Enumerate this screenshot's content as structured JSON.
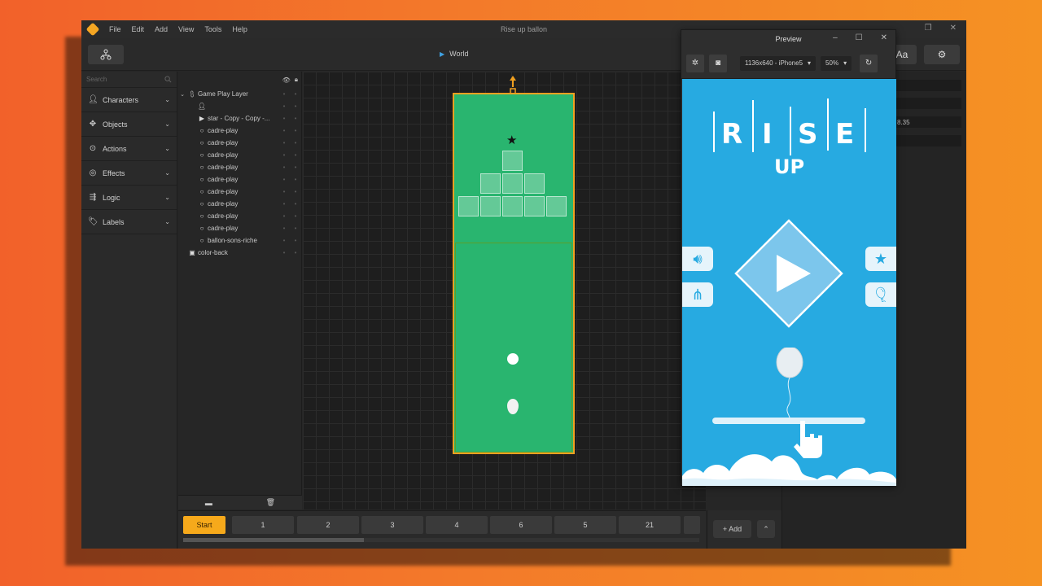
{
  "app": {
    "window_title": "Rise up ballon",
    "menu": [
      "File",
      "Edit",
      "Add",
      "View",
      "Tools",
      "Help"
    ]
  },
  "toolbar": {
    "scene_name": "World",
    "text_button": "Aa"
  },
  "left_panel": {
    "search_placeholder": "Search",
    "categories": [
      {
        "label": "Characters",
        "icon": "person-icon"
      },
      {
        "label": "Objects",
        "icon": "objects-icon"
      },
      {
        "label": "Actions",
        "icon": "play-circle-icon"
      },
      {
        "label": "Effects",
        "icon": "spiral-icon"
      },
      {
        "label": "Logic",
        "icon": "logic-icon"
      },
      {
        "label": "Labels",
        "icon": "tag-icon"
      }
    ]
  },
  "layers": {
    "rows": [
      {
        "name": "Game Play Layer",
        "icon": "layer-icon",
        "level": 0
      },
      {
        "name": "",
        "icon": "person-icon",
        "level": 1
      },
      {
        "name": "star - Copy - Copy -...",
        "icon": "play-icon",
        "level": 1
      },
      {
        "name": "cadre-play",
        "icon": "circle-icon",
        "level": 1
      },
      {
        "name": "cadre-play",
        "icon": "circle-icon",
        "level": 1
      },
      {
        "name": "cadre-play",
        "icon": "circle-icon",
        "level": 1
      },
      {
        "name": "cadre-play",
        "icon": "circle-icon",
        "level": 1
      },
      {
        "name": "cadre-play",
        "icon": "circle-icon",
        "level": 1
      },
      {
        "name": "cadre-play",
        "icon": "circle-icon",
        "level": 1
      },
      {
        "name": "cadre-play",
        "icon": "circle-icon",
        "level": 1
      },
      {
        "name": "cadre-play",
        "icon": "circle-icon",
        "level": 1
      },
      {
        "name": "cadre-play",
        "icon": "circle-icon",
        "level": 1
      },
      {
        "name": "ballon-sons-riche",
        "icon": "circle-icon",
        "level": 1
      },
      {
        "name": "color-back",
        "icon": "image-icon",
        "level": 0
      }
    ]
  },
  "timeline": {
    "scenes": [
      "Start",
      "1",
      "2",
      "3",
      "4",
      "6",
      "5",
      "21"
    ],
    "add_label": "+ Add"
  },
  "properties": {
    "value": "8.35"
  },
  "preview": {
    "title": "Preview",
    "device": "1136x640 - iPhone5",
    "zoom": "50%",
    "game": {
      "logo_letters": [
        "R",
        "I",
        "S",
        "E"
      ],
      "logo_sub": "UP"
    }
  },
  "colors": {
    "accent": "#f6a91b",
    "stage_green": "#29b56f",
    "preview_blue": "#27aae1"
  }
}
